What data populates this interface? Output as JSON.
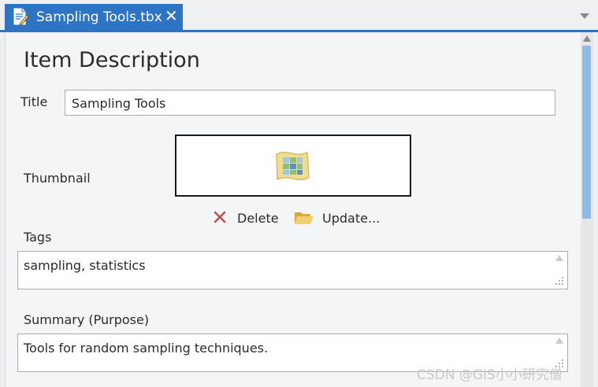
{
  "tab": {
    "label": "Sampling Tools.tbx",
    "close_glyph": "✕"
  },
  "icons": {
    "tab": "document-edit-icon",
    "thumbnail": "map-toolbox-icon",
    "delete": "red-x-icon",
    "update": "folder-open-icon"
  },
  "colors": {
    "accent": "#2e74c4",
    "delete": "#c0504d",
    "folder": "#e8c468",
    "scroll_thumb": "#8dbbe8"
  },
  "form": {
    "heading": "Item Description",
    "title_label": "Title",
    "title_value": "Sampling Tools",
    "thumbnail_label": "Thumbnail",
    "delete_label": "Delete",
    "update_label": "Update...",
    "tags_label": "Tags",
    "tags_value": "sampling, statistics",
    "summary_label": "Summary (Purpose)",
    "summary_value": "Tools for random sampling techniques."
  },
  "watermark": "CSDN @GIS小小研究僧"
}
